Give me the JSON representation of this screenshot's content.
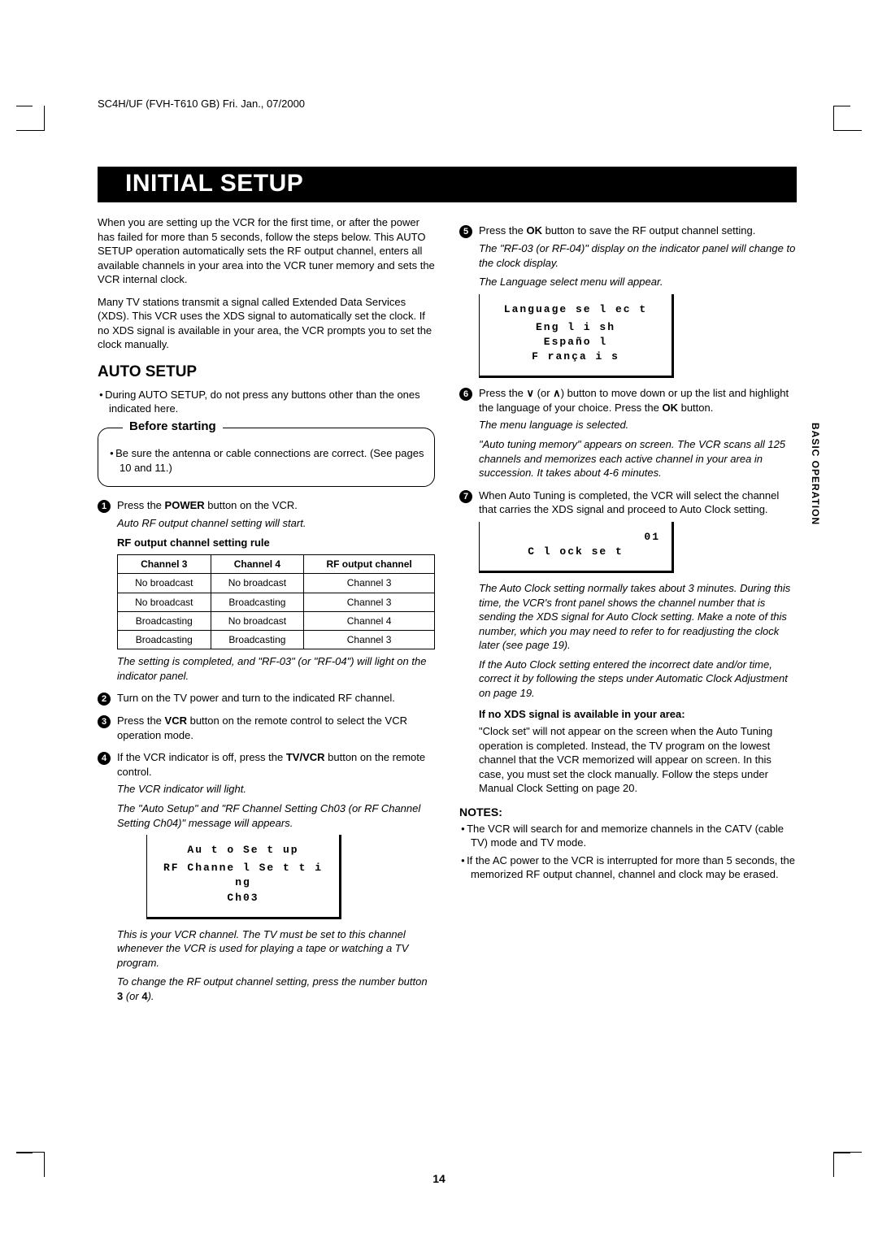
{
  "header": "SC4H/UF (FVH-T610 GB)    Fri. Jan., 07/2000",
  "title": "INITIAL SETUP",
  "side_tab": "BASIC OPERATION",
  "page_number": "14",
  "intro": {
    "p1": "When you are setting up the VCR for the first time, or after the power has failed for more than 5 seconds, follow the steps below. This AUTO SETUP operation automatically sets the RF output channel, enters all available channels in your area into the VCR tuner memory and sets the VCR internal clock.",
    "p2": "Many TV stations transmit a signal called Extended Data Services (XDS). This VCR uses the XDS signal to automatically set the clock. If no XDS signal is available in your area, the VCR prompts you to set the clock manually."
  },
  "auto_setup": {
    "heading": "AUTO SETUP",
    "bullet": "During AUTO SETUP, do not press any buttons other than the ones indicated here."
  },
  "before": {
    "title": "Before starting",
    "bullet": "Be sure the antenna or cable connections are correct. (See pages 10 and 11.)"
  },
  "steps_left": {
    "s1_a": "Press the ",
    "s1_b": "POWER",
    "s1_c": " button on the VCR.",
    "s1_note": "Auto RF output channel setting will start.",
    "rf_rule_title": "RF output channel setting rule",
    "table": {
      "headers": [
        "Channel 3",
        "Channel 4",
        "RF output channel"
      ],
      "rows": [
        [
          "No broadcast",
          "No broadcast",
          "Channel 3"
        ],
        [
          "No broadcast",
          "Broadcasting",
          "Channel 3"
        ],
        [
          "Broadcasting",
          "No broadcast",
          "Channel 4"
        ],
        [
          "Broadcasting",
          "Broadcasting",
          "Channel 3"
        ]
      ]
    },
    "s1_note2": "The setting is completed, and \"RF-03\" (or \"RF-04\") will light on the indicator panel.",
    "s2": "Turn on the TV power and turn to the indicated RF channel.",
    "s3_a": "Press the ",
    "s3_b": "VCR",
    "s3_c": " button on the remote control to select the VCR operation mode.",
    "s4_a": "If the VCR indicator is off, press the ",
    "s4_b": "TV/VCR",
    "s4_c": " button on the remote control.",
    "s4_note1": "The VCR indicator will light.",
    "s4_note2": "The \"Auto Setup\" and \"RF Channel Setting Ch03 (or RF Channel Setting Ch04)\" message will appears.",
    "osd1_l1": "Au t o  Se t up",
    "osd1_l2": "RF  Channe l  Se t t i ng",
    "osd1_l3": "Ch03",
    "s4_note3": "This is your VCR channel. The TV must be set to this channel whenever the VCR is used for playing a tape or watching a TV program.",
    "s4_note4a": "To change the RF output channel setting, press the number button ",
    "s4_note4b": "3",
    "s4_note4c": " (or ",
    "s4_note4d": "4",
    "s4_note4e": ")."
  },
  "steps_right": {
    "s5_a": "Press the ",
    "s5_b": "OK",
    "s5_c": " button to save the RF output channel setting.",
    "s5_note1": "The \"RF-03 (or RF-04)\" display on the indicator panel will change to the clock display.",
    "s5_note2": "The Language select menu will appear.",
    "osd2_title": "Language  se l ec t",
    "osd2_l1": "Eng l i sh",
    "osd2_l2": "Españo l",
    "osd2_l3": "F rança i s",
    "s6_a": "Press the ",
    "s6_down": "∨",
    "s6_mid": " (or ",
    "s6_up": "∧",
    "s6_b": ") button to move down or up the list and highlight the language of your choice. Press the ",
    "s6_c": "OK",
    "s6_d": " button.",
    "s6_note1": "The menu language is selected.",
    "s6_note2": "\"Auto tuning memory\" appears on screen. The VCR scans all 125 channels and memorizes each active channel in your area in succession. It takes about 4-6 minutes.",
    "s7": "When Auto Tuning is completed, the VCR will select the channel that carries the XDS signal and proceed to Auto Clock setting.",
    "osd3_label": "C l ock  se t",
    "osd3_value": "01",
    "s7_note1": "The Auto Clock setting normally takes about 3 minutes. During this time, the VCR's front panel shows the channel number that is sending the XDS signal for Auto Clock setting. Make a note of this number, which you may need to refer to for readjusting the clock later (see page 19).",
    "s7_note2": "If the Auto Clock setting entered the incorrect date and/or time, correct it by following the steps under Automatic Clock Adjustment on page 19.",
    "noxds_title": "If no XDS signal is available in your area:",
    "noxds_body": "\"Clock set\" will not appear on the screen when the Auto Tuning operation is completed. Instead, the TV program on the lowest channel that the VCR memorized will appear on screen. In this case, you must set the clock manually. Follow the steps under Manual Clock Setting on page 20."
  },
  "notes": {
    "heading": "NOTES:",
    "n1": "The VCR will search for and memorize channels in the CATV (cable TV) mode and TV mode.",
    "n2": "If the AC power to the VCR is interrupted for more than 5 seconds, the memorized RF output channel, channel and clock may be erased."
  }
}
